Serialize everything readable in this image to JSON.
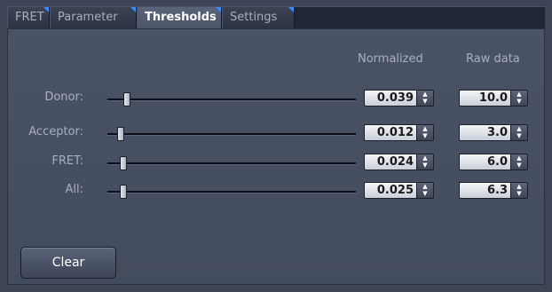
{
  "tabs": [
    {
      "label": "FRET"
    },
    {
      "label": "Parameter"
    },
    {
      "label": "Thresholds"
    },
    {
      "label": "Settings"
    }
  ],
  "active_tab": "Thresholds",
  "columns": {
    "normalized": "Normalized",
    "raw": "Raw data"
  },
  "rows": [
    {
      "label": "Donor:",
      "normalized": "0.039",
      "raw": "10.0",
      "slider_fraction": 0.039
    },
    {
      "label": "Acceptor:",
      "normalized": "0.012",
      "raw": "3.0",
      "slider_fraction": 0.012
    },
    {
      "label": "FRET:",
      "normalized": "0.024",
      "raw": "6.0",
      "slider_fraction": 0.024
    },
    {
      "label": "All:",
      "normalized": "0.025",
      "raw": "6.3",
      "slider_fraction": 0.025
    }
  ],
  "clear_label": "Clear",
  "colors": {
    "panel": "#434c5e",
    "tabbar": "#202633",
    "active_tab": "#59647a",
    "accent": "#3a8cff"
  }
}
